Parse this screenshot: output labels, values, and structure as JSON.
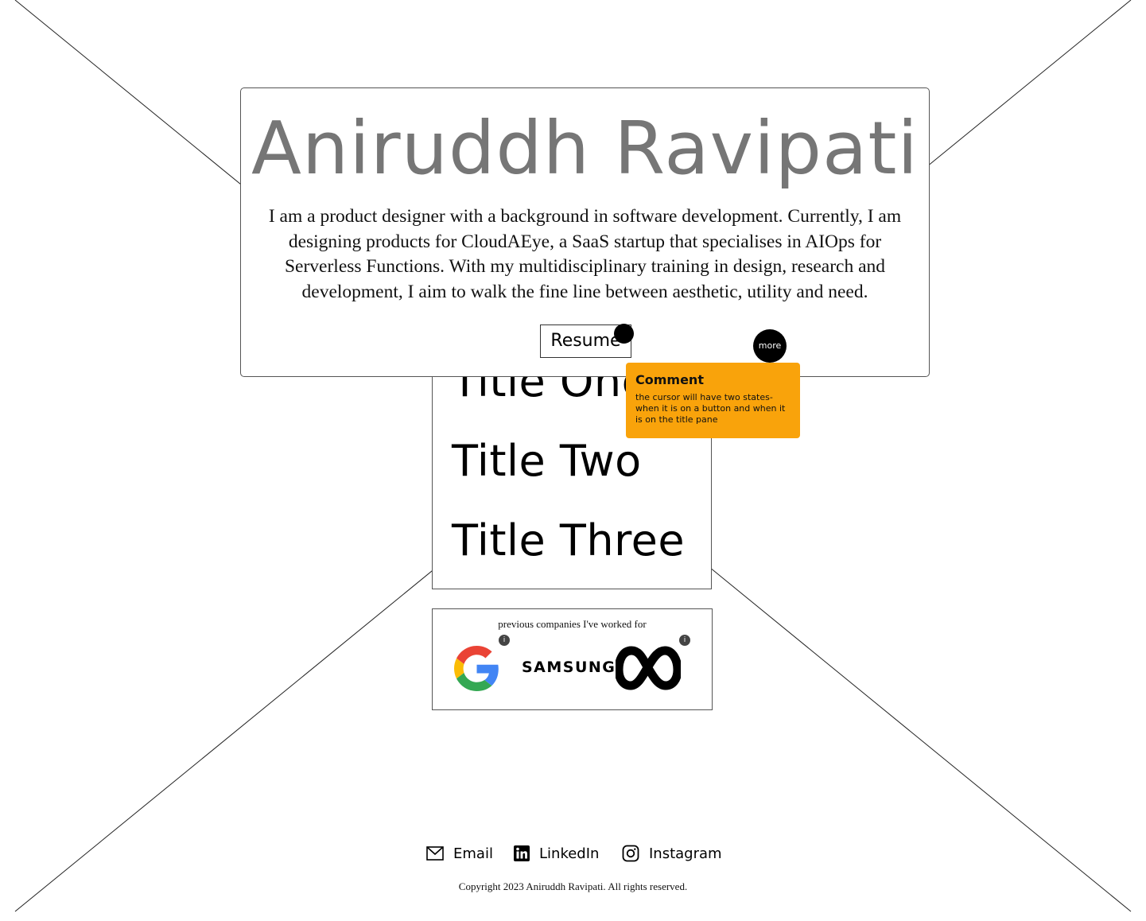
{
  "hero": {
    "name": "Aniruddh Ravipati",
    "bio": "I am a product designer with a background in software development. Currently, I am designing products for CloudAEye, a SaaS startup that specialises in AIOps for Serverless Functions. With my multidisciplinary training in design, research and development, I aim to walk the fine line between aesthetic, utility and need.",
    "resume_label": "Resume",
    "more_label": "more"
  },
  "titles": [
    {
      "label": "Title One"
    },
    {
      "label": "Title Two"
    },
    {
      "label": "Title Three"
    }
  ],
  "comment": {
    "title": "Comment",
    "body": "the cursor will have two states- when it is on a button and when it is on the title pane"
  },
  "companies": {
    "caption": "previous companies I've worked for",
    "info_label": "i",
    "logos": [
      {
        "name": "Google",
        "icon": "google-logo"
      },
      {
        "name": "SAMSUNG",
        "icon": "samsung-logo"
      },
      {
        "name": "Meta",
        "icon": "meta-logo"
      }
    ]
  },
  "footer": {
    "links": [
      {
        "label": "Email",
        "icon": "mail-icon"
      },
      {
        "label": "LinkedIn",
        "icon": "linkedin-icon"
      },
      {
        "label": "Instagram",
        "icon": "instagram-icon"
      }
    ],
    "copyright": "Copyright 2023 Aniruddh Ravipati. All rights reserved."
  },
  "colors": {
    "name_gray": "#767676",
    "comment_bg": "#f9a30b",
    "google_blue": "#4285F4",
    "google_red": "#EA4335",
    "google_yellow": "#FBBC05",
    "google_green": "#34A853"
  }
}
